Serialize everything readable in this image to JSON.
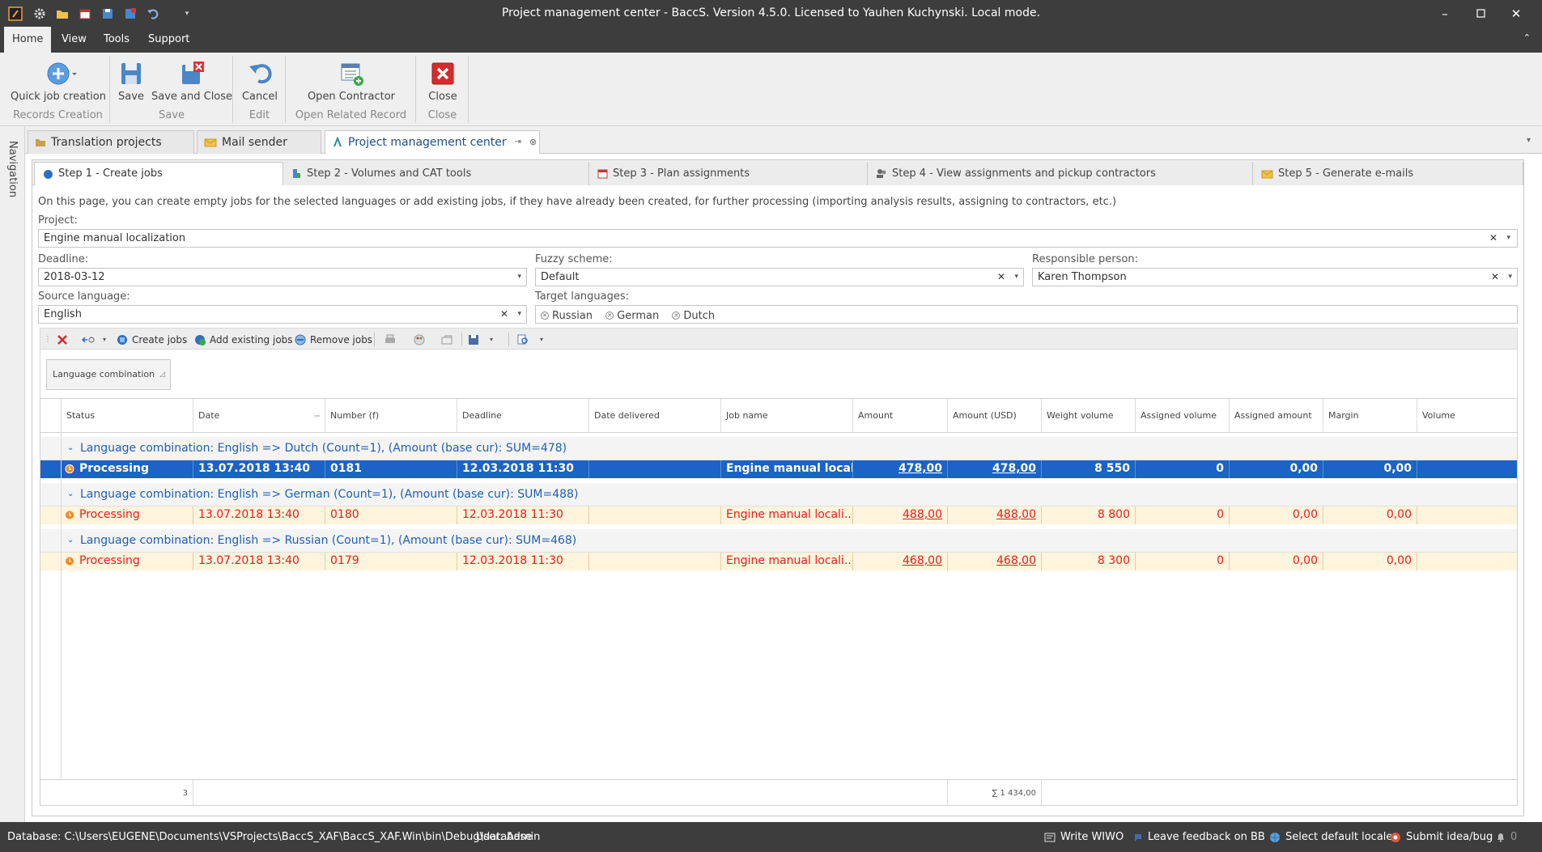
{
  "window": {
    "title": "Project management center - BaccS. Version 4.5.0. Licensed to Yauhen Kuchynski. Local mode."
  },
  "menu": {
    "tabs": [
      "Home",
      "View",
      "Tools",
      "Support"
    ],
    "active": "Home"
  },
  "ribbon": {
    "groups": [
      {
        "label": "Records Creation",
        "buttons": [
          {
            "label": "Quick job creation",
            "icon": "plus-icon"
          }
        ]
      },
      {
        "label": "Save",
        "buttons": [
          {
            "label": "Save",
            "icon": "save-icon"
          },
          {
            "label": "Save and Close",
            "icon": "save-close-icon"
          }
        ]
      },
      {
        "label": "Edit",
        "buttons": [
          {
            "label": "Cancel",
            "icon": "undo-icon"
          }
        ]
      },
      {
        "label": "Open Related Record",
        "buttons": [
          {
            "label": "Open Contractor",
            "icon": "open-contractor-icon"
          }
        ]
      },
      {
        "label": "Close",
        "buttons": [
          {
            "label": "Close",
            "icon": "close-icon"
          }
        ]
      }
    ]
  },
  "navigation": {
    "label": "Navigation"
  },
  "doc_tabs": [
    {
      "label": "Translation projects",
      "icon": "folder-icon"
    },
    {
      "label": "Mail sender",
      "icon": "mail-icon"
    },
    {
      "label": "Project management center",
      "icon": "pm-icon",
      "active": true
    }
  ],
  "step_tabs": [
    {
      "label": "Step 1 - Create jobs",
      "active": true
    },
    {
      "label": "Step 2 - Volumes and CAT tools"
    },
    {
      "label": "Step 3 - Plan assignments"
    },
    {
      "label": "Step 4 - View assignments and pickup contractors"
    },
    {
      "label": "Step 5 - Generate e-mails"
    }
  ],
  "form": {
    "hint": "On this page, you can create empty jobs for the selected languages or add existing jobs, if they have already been created, for further processing (importing analysis results, assigning to contractors, etc.)",
    "project_label": "Project:",
    "project_value": "Engine manual localization",
    "deadline_label": "Deadline:",
    "deadline_value": "2018-03-12",
    "fuzzy_label": "Fuzzy scheme:",
    "fuzzy_value": "Default",
    "responsible_label": "Responsible person:",
    "responsible_value": "Karen Thompson",
    "source_label": "Source language:",
    "source_value": "English",
    "target_label": "Target languages:",
    "target_values": [
      "Russian",
      "German",
      "Dutch"
    ]
  },
  "toolbar": {
    "create_jobs": "Create jobs",
    "add_existing": "Add existing jobs",
    "remove_jobs": "Remove jobs"
  },
  "grid": {
    "group_by_chip": "Language combination",
    "columns": [
      "Status",
      "Date",
      "Number (f)",
      "Deadline",
      "Date delivered",
      "Job name",
      "Amount",
      "Amount (USD)",
      "Weight volume",
      "Assigned volume",
      "Assigned amount",
      "Margin",
      "Volume"
    ],
    "groups": [
      {
        "label": "Language combination: English => Dutch (Count=1), (Amount (base cur): SUM=478)",
        "rows": [
          {
            "status": "Processing",
            "date": "13.07.2018 13:40",
            "number": "0181",
            "deadline": "12.03.2018 11:30",
            "date_delivered": "",
            "job_name": "Engine manual locali...",
            "amount": "478,00",
            "amount_usd": "478,00",
            "weight_volume": "8 550",
            "assigned_volume": "0",
            "assigned_amount": "0,00",
            "margin": "0,00",
            "volume": "",
            "selected": true
          }
        ]
      },
      {
        "label": "Language combination: English => German (Count=1), (Amount (base cur): SUM=488)",
        "rows": [
          {
            "status": "Processing",
            "date": "13.07.2018 13:40",
            "number": "0180",
            "deadline": "12.03.2018 11:30",
            "date_delivered": "",
            "job_name": "Engine manual locali...",
            "amount": "488,00",
            "amount_usd": "488,00",
            "weight_volume": "8 800",
            "assigned_volume": "0",
            "assigned_amount": "0,00",
            "margin": "0,00",
            "volume": ""
          }
        ]
      },
      {
        "label": "Language combination: English => Russian (Count=1), (Amount (base cur): SUM=468)",
        "rows": [
          {
            "status": "Processing",
            "date": "13.07.2018 13:40",
            "number": "0179",
            "deadline": "12.03.2018 11:30",
            "date_delivered": "",
            "job_name": "Engine manual locali...",
            "amount": "468,00",
            "amount_usd": "468,00",
            "weight_volume": "8 300",
            "assigned_volume": "0",
            "assigned_amount": "0,00",
            "margin": "0,00",
            "volume": ""
          }
        ]
      }
    ],
    "footer": {
      "count": "3",
      "amount_usd_sum": "∑ 1 434,00"
    }
  },
  "statusbar": {
    "database": "Database: C:\\Users\\EUGENE\\Documents\\VSProjects\\BaccS_XAF\\BaccS_XAF.Win\\bin\\Debug\\database",
    "user": "User: Admin",
    "write_wiwo": "Write WIWO",
    "leave_feedback": "Leave feedback on BB",
    "select_locale": "Select default locale",
    "submit_idea": "Submit idea/bug",
    "notifications": "0"
  },
  "colors": {
    "chrome_dark": "#3d3d3d",
    "selected_row": "#1c62c7",
    "row_highlight": "#fff4dc",
    "red_text": "#e02020",
    "group_blue": "#1f5fb3"
  }
}
